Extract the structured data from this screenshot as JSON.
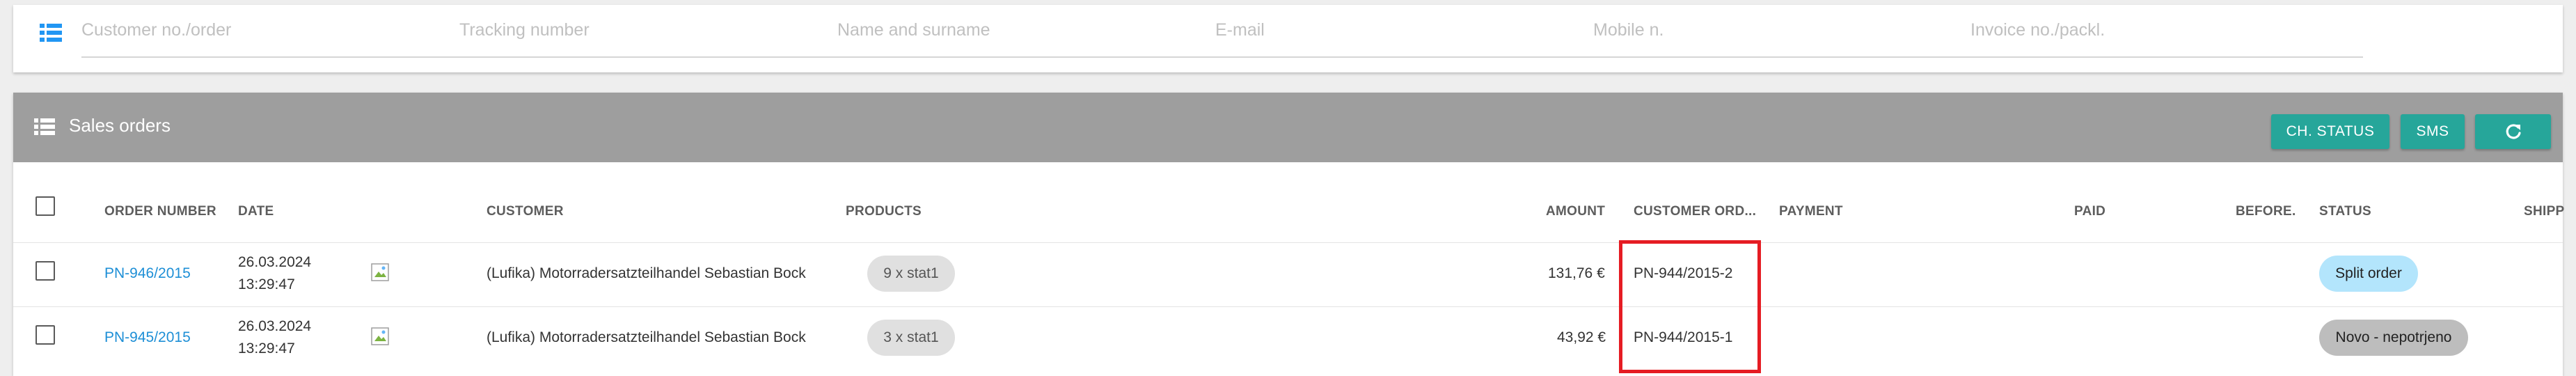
{
  "search": {
    "placeholders": {
      "customer": "Customer no./order",
      "tracking": "Tracking number",
      "name": "Name and surname",
      "email": "E-mail",
      "mobile": "Mobile n.",
      "invoice": "Invoice no./packl."
    }
  },
  "panel": {
    "title": "Sales orders",
    "buttons": {
      "ch_status": "CH. STATUS",
      "sms": "SMS",
      "refresh_icon": "refresh-icon"
    }
  },
  "table": {
    "columns": {
      "order_number": "ORDER NUMBER",
      "date": "DATE",
      "customer": "CUSTOMER",
      "products": "PRODUCTS",
      "amount": "AMOUNT",
      "customer_order": "CUSTOMER ORD...",
      "payment": "PAYMENT",
      "paid": "PAID",
      "before": "BEFORE.",
      "status": "STATUS",
      "shipping": "SHIPP"
    },
    "rows": [
      {
        "order_number": "PN-946/2015",
        "date_day": "26.03.2024",
        "date_time": "13:29:47",
        "customer": "(Lufika) Motorradersatzteilhandel Sebastian Bock",
        "products": "9 x stat1",
        "amount": "131,76 €",
        "customer_order": "PN-944/2015-2",
        "status": "Split order"
      },
      {
        "order_number": "PN-945/2015",
        "date_day": "26.03.2024",
        "date_time": "13:29:47",
        "customer": "(Lufika) Motorradersatzteilhandel Sebastian Bock",
        "products": "3 x stat1",
        "amount": "43,92 €",
        "customer_order": "PN-944/2015-1",
        "status": "Novo - nepotrjeno"
      }
    ]
  },
  "colors": {
    "accent": "#26a69a",
    "link": "#1e8fd6",
    "header_bg": "#9e9e9e",
    "highlight": "#e51c23",
    "status_split": "#b3e5fc",
    "status_novo": "#bdbdbd"
  }
}
